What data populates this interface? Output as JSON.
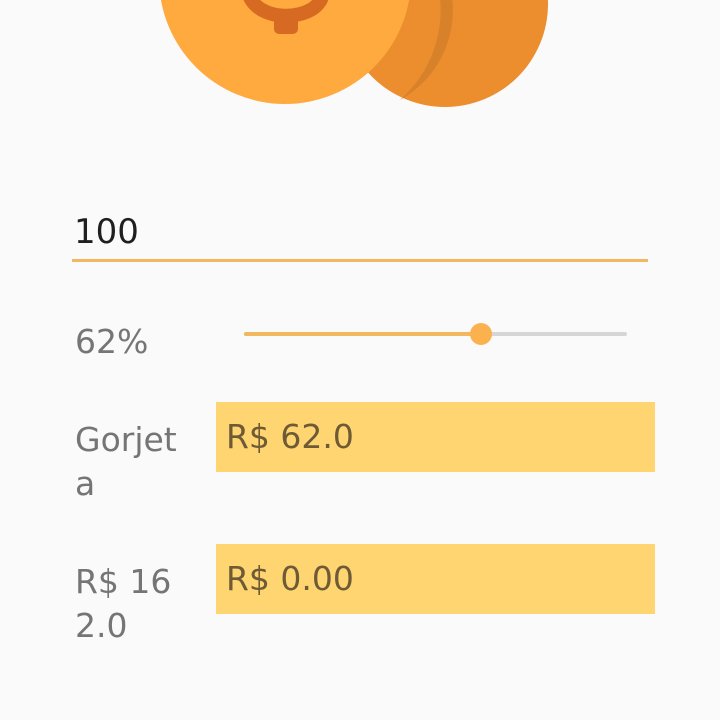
{
  "colors": {
    "accent": "#f2b860",
    "field_background": "#ffd571",
    "coin_front": "#ffaa3f",
    "coin_back": "#ec8d2e",
    "coin_symbol": "#d66a23"
  },
  "amount_input": {
    "value": "100"
  },
  "tip_percent": {
    "label": "62%",
    "slider_value_fraction": 0.62
  },
  "tip_row": {
    "label": "Gorjeta",
    "value": "R$ 62.0"
  },
  "total_row": {
    "label": "R$ 162.0",
    "value": "R$ 0.00"
  },
  "icons": [
    "coin-logo-icon"
  ]
}
